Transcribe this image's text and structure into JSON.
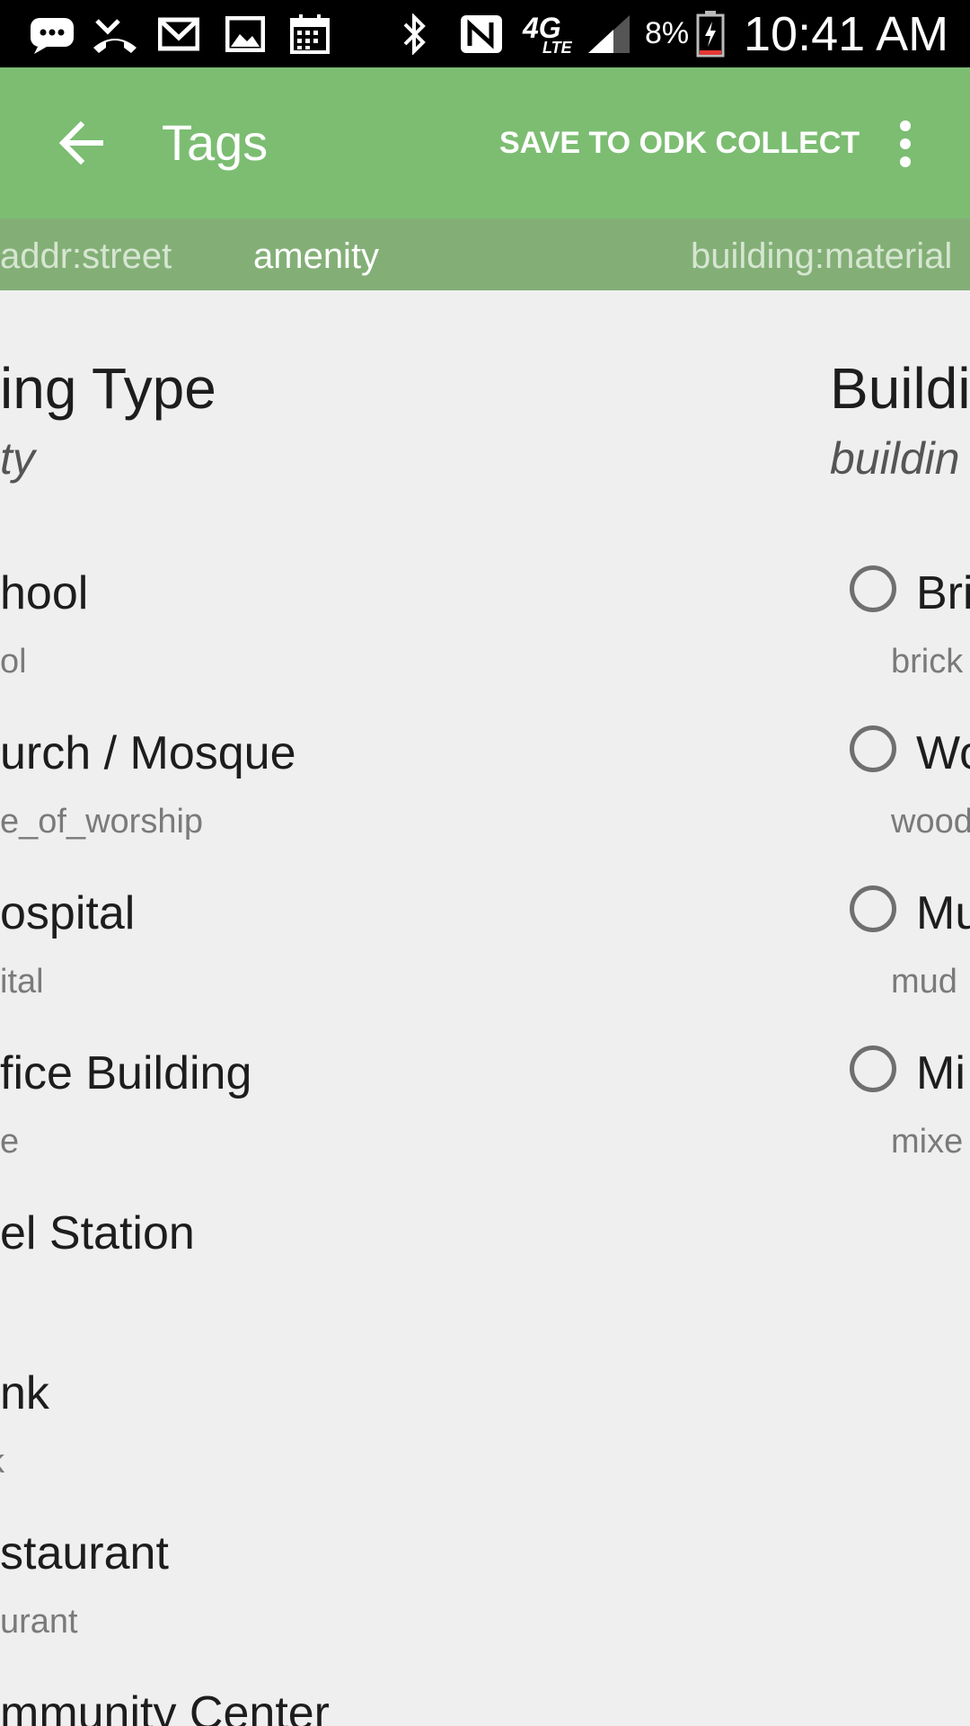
{
  "status_bar": {
    "icons": [
      "message-icon",
      "missed-call-icon",
      "gmail-icon",
      "gallery-icon",
      "calendar-icon",
      "bluetooth-icon",
      "nfc-icon",
      "lte-icon",
      "signal-icon",
      "battery-icon"
    ],
    "network_label": "4G",
    "battery_percent": "8%",
    "time": "10:41 AM"
  },
  "app_bar": {
    "title": "Tags",
    "save_label": "SAVE TO ODK COLLECT",
    "background": "#7CBD72"
  },
  "tabs": {
    "items": [
      "addr:street",
      "amenity",
      "building:material"
    ],
    "active_index": 1,
    "background": "#83AF77"
  },
  "left_panel": {
    "title": "ing Type",
    "key": "ty",
    "options": [
      {
        "label": "hool",
        "value": "ol"
      },
      {
        "label": "urch /  Mosque",
        "value": "e_of_worship"
      },
      {
        "label": "ospital",
        "value": "ital"
      },
      {
        "label": "fice Building",
        "value": "e"
      },
      {
        "label": "el Station",
        "value": ""
      },
      {
        "label": "nk",
        "value": "k"
      },
      {
        "label": "staurant",
        "value": "urant"
      },
      {
        "label": "mmunity Center",
        "value": ""
      }
    ]
  },
  "right_panel": {
    "title": "Buildi",
    "key": "buildin",
    "options": [
      {
        "label": "Bri",
        "value": "brick"
      },
      {
        "label": "Wo",
        "value": "wood"
      },
      {
        "label": "Mu",
        "value": "mud"
      },
      {
        "label": "Mi",
        "value": "mixe"
      }
    ]
  }
}
